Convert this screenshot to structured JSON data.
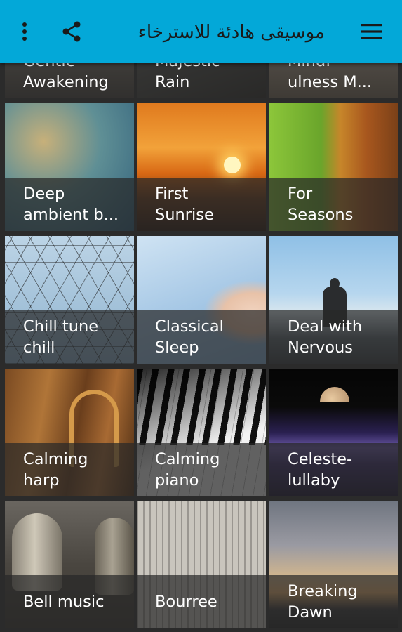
{
  "app": {
    "title": "موسيقى هادئة للاسترخاء"
  },
  "icons": {
    "menu": "hamburger-menu-icon",
    "share": "share-icon",
    "more": "more-vertical-icon"
  },
  "colors": {
    "appbar": "#03a8d8",
    "background": "#2b2b2b",
    "label_overlay": "rgba(40,40,40,0.72)"
  },
  "tiles": [
    {
      "label": "Gentle\nAwakening"
    },
    {
      "label": "Majestic\nRain"
    },
    {
      "label": "Mindf\nulness M..."
    },
    {
      "label": "Deep\nambient b..."
    },
    {
      "label": "First\nSunrise"
    },
    {
      "label": "For\nSeasons"
    },
    {
      "label": "Chill tune\nchill"
    },
    {
      "label": "Classical\nSleep"
    },
    {
      "label": "Deal with\nNervous"
    },
    {
      "label": "Calming\nharp"
    },
    {
      "label": "Calming\npiano"
    },
    {
      "label": "Celeste-\nlullaby"
    },
    {
      "label": "Bell music"
    },
    {
      "label": "Bourree"
    },
    {
      "label": "Breaking\nDawn"
    }
  ]
}
